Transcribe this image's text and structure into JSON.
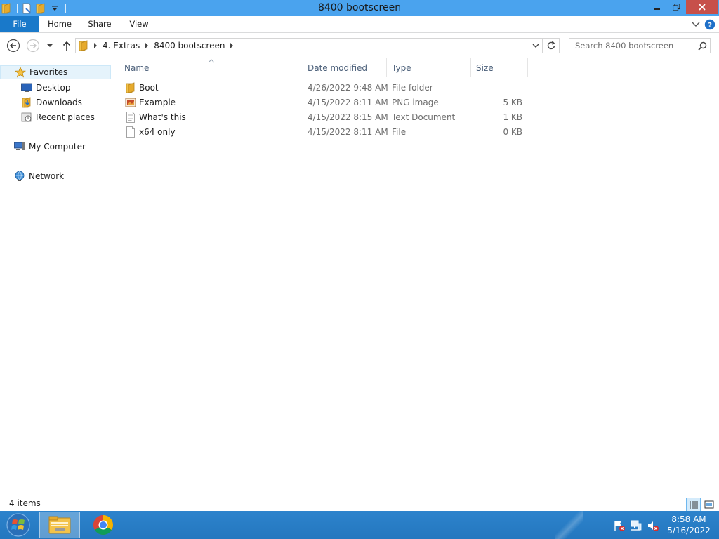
{
  "window": {
    "title": "8400 bootscreen"
  },
  "ribbon": {
    "tabs": [
      "File",
      "Home",
      "Share",
      "View"
    ]
  },
  "address": {
    "breadcrumbs": [
      "4. Extras",
      "8400 bootscreen"
    ]
  },
  "search": {
    "placeholder": "Search 8400 bootscreen"
  },
  "navpane": {
    "favorites": "Favorites",
    "desktop": "Desktop",
    "downloads": "Downloads",
    "recent": "Recent places",
    "computer": "My Computer",
    "network": "Network"
  },
  "columns": {
    "name": "Name",
    "date": "Date modified",
    "type": "Type",
    "size": "Size"
  },
  "files": [
    {
      "name": "Boot",
      "date": "4/26/2022 9:48 AM",
      "type": "File folder",
      "size": "",
      "icon": "folder-icon"
    },
    {
      "name": "Example",
      "date": "4/15/2022 8:11 AM",
      "type": "PNG image",
      "size": "5 KB",
      "icon": "png-image-icon"
    },
    {
      "name": "What's this",
      "date": "4/15/2022 8:15 AM",
      "type": "Text Document",
      "size": "1 KB",
      "icon": "text-document-icon"
    },
    {
      "name": "x64 only",
      "date": "4/15/2022 8:11 AM",
      "type": "File",
      "size": "0 KB",
      "icon": "blank-file-icon"
    }
  ],
  "status": {
    "item_count": "4 items"
  },
  "clock": {
    "time": "8:58 AM",
    "date": "5/16/2022"
  },
  "colors": {
    "titlebar": "#4aa3ee",
    "file_tab": "#1979ca",
    "close_button": "#c7504a",
    "taskbar": "#2477bf",
    "selection": "#e5f3fb"
  }
}
